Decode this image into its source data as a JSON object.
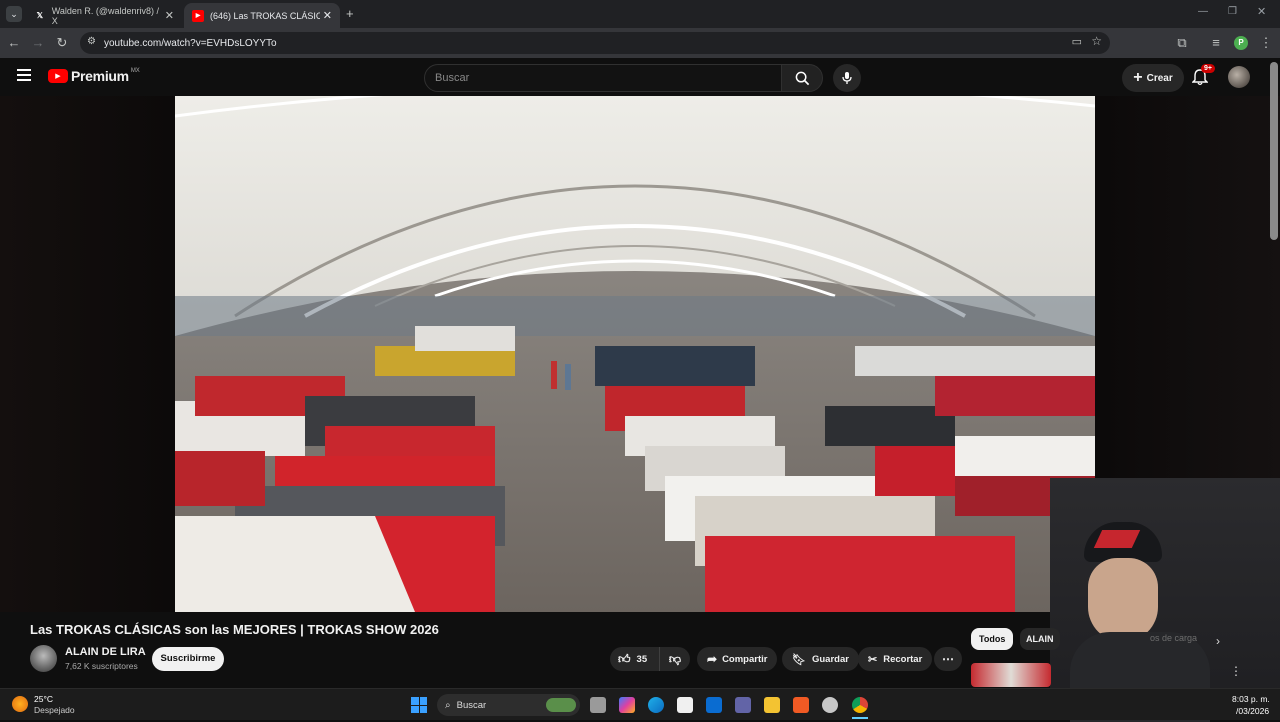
{
  "browser": {
    "tabs": [
      {
        "title": "Walden R. (@waldenriv8) / X",
        "favicon": "x-logo"
      },
      {
        "title": "(646) Las TROKAS CLÁSICAS so",
        "favicon": "youtube-logo"
      }
    ],
    "url": "youtube.com/watch?v=EVHDsLOYYTo",
    "profile_initial": "P"
  },
  "youtube": {
    "logo_text": "Premium",
    "region": "MX",
    "search_placeholder": "Buscar",
    "create_label": "Crear",
    "notifications_badge": "9+"
  },
  "video": {
    "title": "Las TROKAS CLÁSICAS son las MEJORES | TROKAS SHOW 2026",
    "channel": "ALAIN DE LIRA",
    "subscribers": "7,62 K suscriptores",
    "subscribe_label": "Suscribirme",
    "likes": "35",
    "share_label": "Compartir",
    "save_label": "Guardar",
    "clip_label": "Recortar"
  },
  "chips": [
    "Todos",
    "ALAIN"
  ],
  "recommendation_partial": "os de carga",
  "taskbar": {
    "weather_temp": "25°C",
    "weather_desc": "Despejado",
    "search_label": "Buscar",
    "time": "8:03 p. m.",
    "date": "/03/2026"
  },
  "colors": {
    "youtube_red": "#ff0000",
    "background": "#0f0f0f",
    "badge_red": "#cc0000"
  }
}
